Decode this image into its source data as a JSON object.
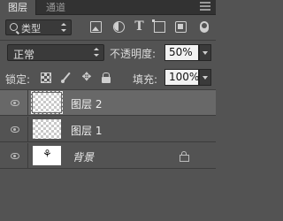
{
  "tabs": [
    {
      "label": "图层",
      "active": true
    },
    {
      "label": "通道",
      "active": false
    }
  ],
  "filter": {
    "kind_label": "类型",
    "icons": [
      "image-filter-icon",
      "adjustment-filter-icon",
      "type-filter-icon",
      "shape-filter-icon",
      "smart-object-filter-icon"
    ]
  },
  "blend": {
    "mode": "正常",
    "opacity_label": "不透明度:",
    "opacity_value": "50%"
  },
  "lock": {
    "label": "锁定:",
    "fill_label": "填充:",
    "fill_value": "100%"
  },
  "layers": [
    {
      "name": "图层 2",
      "selected": true,
      "visible": true
    },
    {
      "name": "图层 1",
      "selected": false,
      "visible": true
    },
    {
      "name": "背景",
      "selected": false,
      "visible": true,
      "locked": true
    }
  ],
  "colors": {
    "panel_bg": "#535353",
    "selected_row": "#686868",
    "tab_bar": "#323232"
  }
}
